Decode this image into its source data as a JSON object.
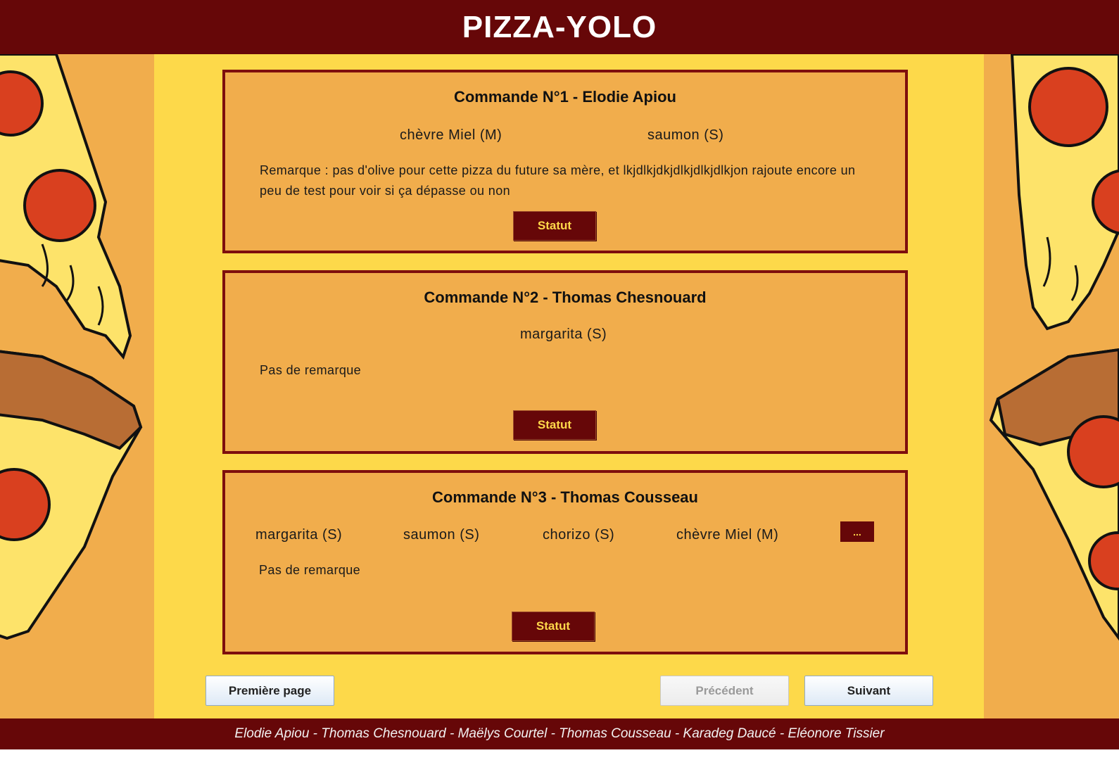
{
  "app": {
    "title": "PIZZA-YOLO"
  },
  "orders": [
    {
      "title": "Commande N°1 - Elodie Apiou",
      "pizzas": [
        "chèvre Miel (M)",
        "saumon (S)"
      ],
      "remark": "Remarque : pas d'olive pour cette pizza du future sa mère, et lkjdlkjdkjdlkjdlkjdlkjon rajoute encore un peu de test pour voir si ça dépasse ou non",
      "status_label": "Statut"
    },
    {
      "title": "Commande N°2 - Thomas Chesnouard",
      "pizzas": [
        "margarita (S)"
      ],
      "remark": "Pas de remarque",
      "status_label": "Statut"
    },
    {
      "title": "Commande N°3 - Thomas Cousseau",
      "pizzas": [
        "margarita (S)",
        "saumon (S)",
        "chorizo (S)",
        "chèvre Miel (M)"
      ],
      "more_label": "...",
      "remark": "Pas de remarque",
      "status_label": "Statut"
    }
  ],
  "pagination": {
    "first_label": "Première page",
    "prev_label": "Précédent",
    "next_label": "Suivant",
    "prev_disabled": true
  },
  "footer": {
    "credits": "Elodie Apiou - Thomas Chesnouard - Maëlys Courtel - Thomas Cousseau - Karadeg Daucé - Eléonore Tissier"
  },
  "colors": {
    "brand_dark": "#660708",
    "background_yellow": "#fdd94a",
    "card_orange": "#f1ad4c",
    "accent_text": "#ffd84a"
  },
  "decor": {
    "left": "pizza-slice-illustration",
    "right": "pizza-slice-illustration"
  }
}
